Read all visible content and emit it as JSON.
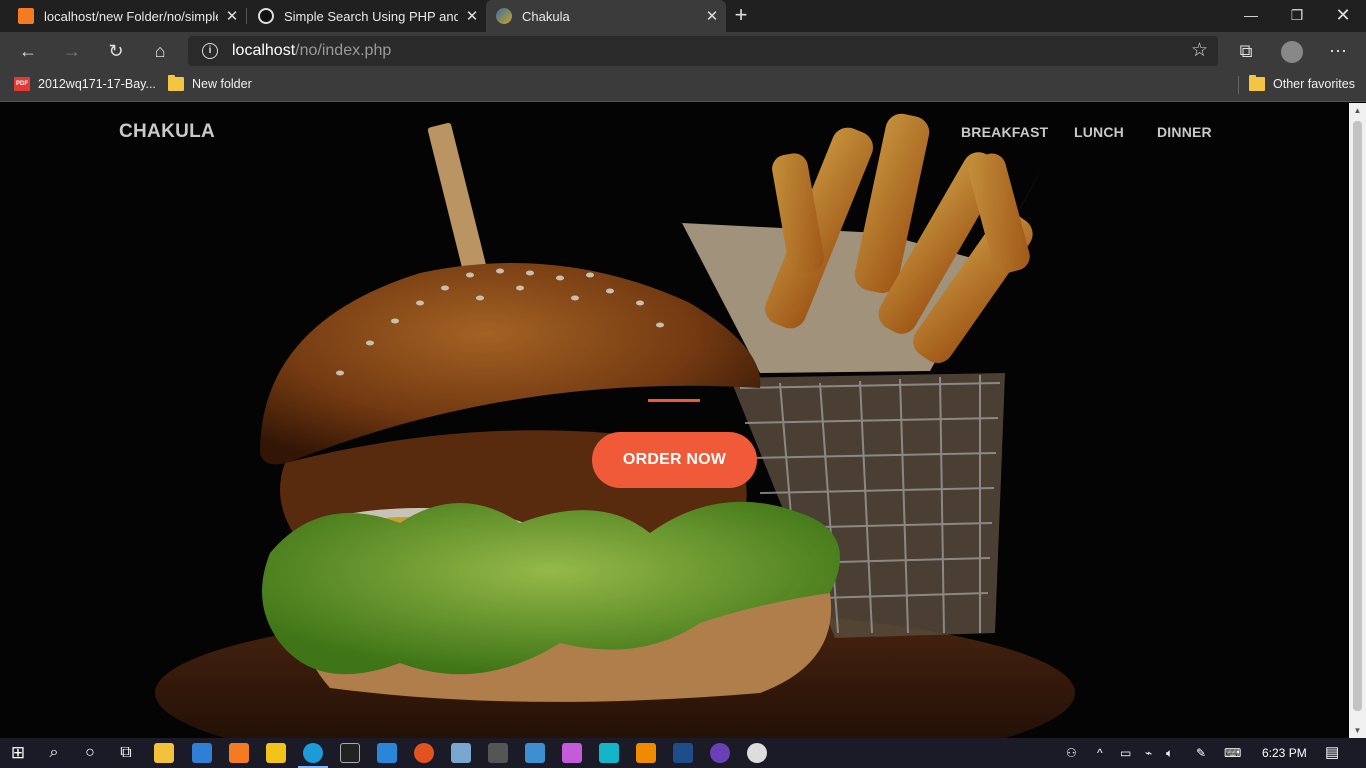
{
  "browser": {
    "tabs": [
      {
        "title": "localhost/new Folder/no/simple",
        "favicon": "xampp-icon",
        "active": false
      },
      {
        "title": "Simple Search Using PHP and My",
        "favicon": "github-icon",
        "active": false
      },
      {
        "title": "Chakula",
        "favicon": "site-icon",
        "active": true
      }
    ],
    "address": {
      "host": "localhost",
      "path": "/no/index.php"
    },
    "bookmarks": [
      {
        "label": "2012wq171-17-Bay...",
        "icon": "pdf-icon"
      },
      {
        "label": "New folder",
        "icon": "folder-icon"
      }
    ],
    "other_favorites": "Other favorites"
  },
  "site": {
    "brand": "CHAKULA",
    "nav": [
      "BREAKFAST",
      "LUNCH",
      "DINNER"
    ],
    "cta": "ORDER NOW",
    "accent_color": "#f05a38"
  },
  "taskbar": {
    "time": "6:23 PM"
  }
}
